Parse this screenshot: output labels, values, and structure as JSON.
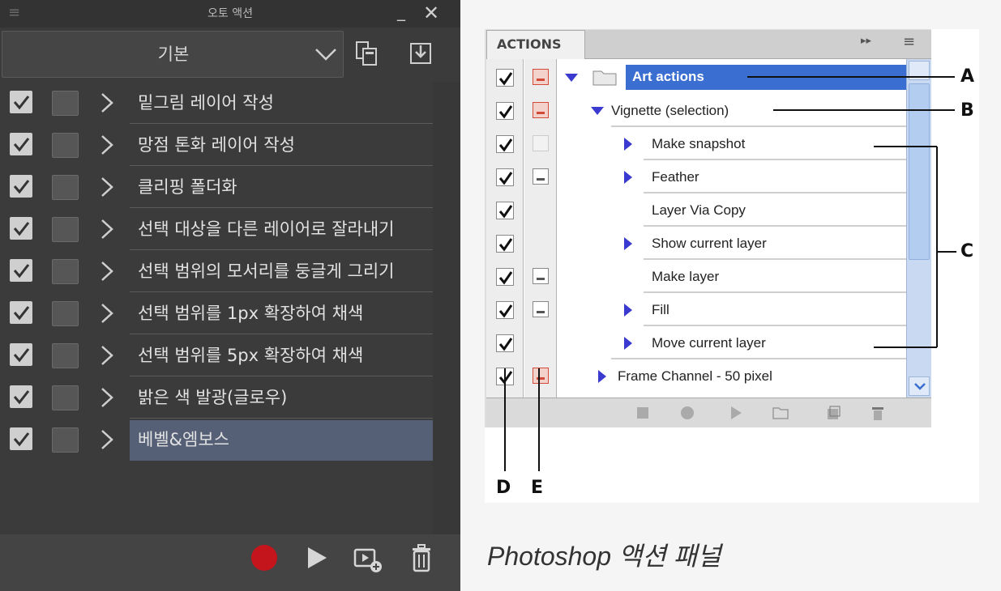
{
  "auto_action": {
    "title": "오토 액션",
    "set_name": "기본",
    "actions": [
      {
        "name": "밑그림 레이어 작성",
        "selected": false
      },
      {
        "name": "망점 톤화 레이어 작성",
        "selected": false
      },
      {
        "name": "클리핑 폴더화",
        "selected": false
      },
      {
        "name": "선택 대상을 다른 레이어로 잘라내기",
        "selected": false
      },
      {
        "name": "선택 범위의 모서리를 둥글게 그리기",
        "selected": false
      },
      {
        "name": "선택 범위를 1px 확장하여 채색",
        "selected": false
      },
      {
        "name": "선택 범위를 5px 확장하여 채색",
        "selected": false
      },
      {
        "name": "밝은 색 발광(글로우)",
        "selected": false
      },
      {
        "name": "베벨&엠보스",
        "selected": true
      }
    ],
    "colors": {
      "record": "#c4151c",
      "selection": "#555f75"
    }
  },
  "photoshop_panel": {
    "tab": "ACTIONS",
    "rows": [
      {
        "name": "Art actions",
        "indent": 0
      },
      {
        "name": "Vignette (selection)",
        "indent": 1
      },
      {
        "name": "Make snapshot",
        "indent": 2
      },
      {
        "name": "Feather",
        "indent": 2
      },
      {
        "name": "Layer Via Copy",
        "indent": 2
      },
      {
        "name": "Show current layer",
        "indent": 2
      },
      {
        "name": "Make layer",
        "indent": 2
      },
      {
        "name": "Fill",
        "indent": 2
      },
      {
        "name": "Move current layer",
        "indent": 2
      },
      {
        "name": "Frame Channel - 50 pixel",
        "indent": 0
      }
    ],
    "callouts": [
      "A",
      "B",
      "C",
      "D",
      "E"
    ]
  },
  "caption": "Photoshop 액션 패널"
}
